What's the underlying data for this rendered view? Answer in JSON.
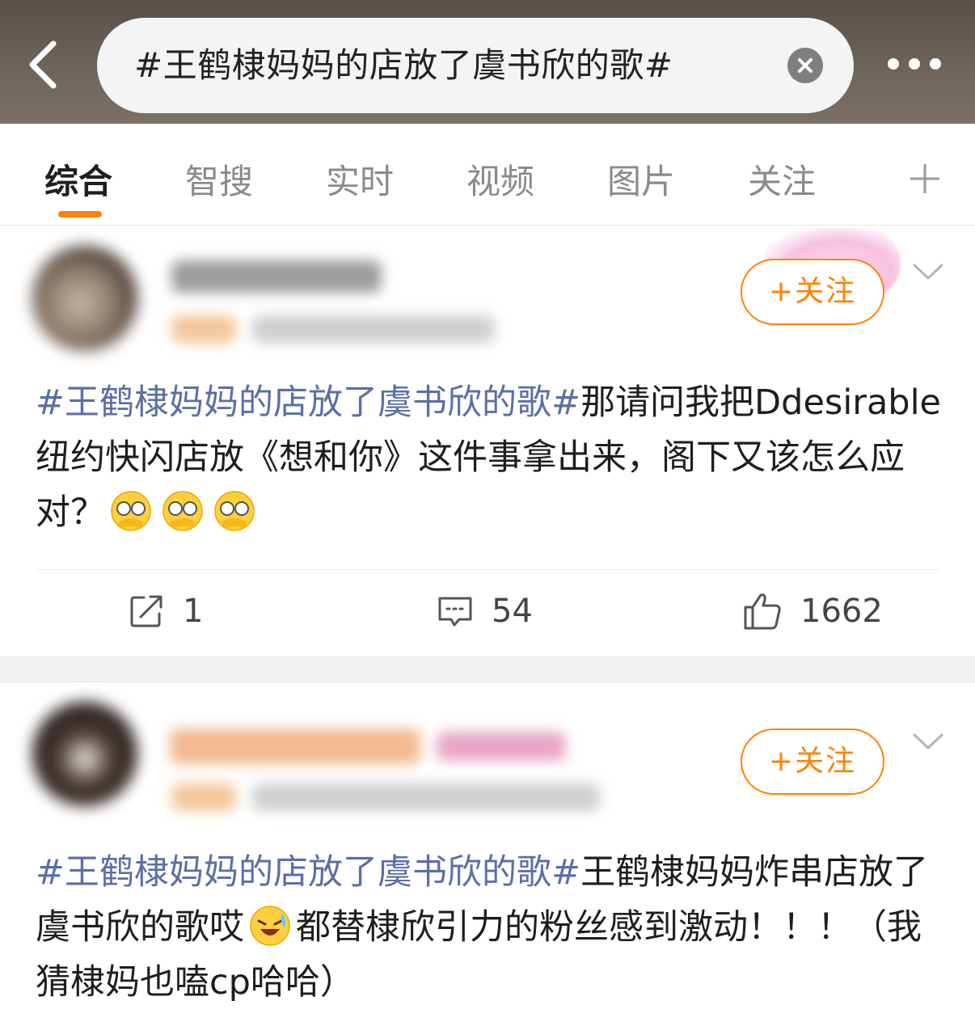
{
  "search": {
    "query": "#王鹤棣妈妈的店放了虞书欣的歌#"
  },
  "colors": {
    "accent": "#ff8200",
    "topic_link": "#5b6fa6",
    "topbar": "#6d645b"
  },
  "icons": {
    "back": "chevron-left-icon",
    "clear": "clear-icon",
    "more": "more-icon",
    "add_tab": "plus-icon",
    "repost": "repost-icon",
    "comment": "comment-icon",
    "like": "thumbs-up-icon",
    "post_menu": "chevron-down-icon"
  },
  "tabs": [
    {
      "label": "综合",
      "active": true
    },
    {
      "label": "智搜",
      "active": false
    },
    {
      "label": "实时",
      "active": false
    },
    {
      "label": "视频",
      "active": false
    },
    {
      "label": "图片",
      "active": false
    },
    {
      "label": "关注",
      "active": false
    }
  ],
  "posts": [
    {
      "follow_label": "+关注",
      "topic": "#王鹤棣妈妈的店放了虞书欣的歌#",
      "text": "那请问我把Ddesirable纽约快闪店放《想和你》这件事拿出来，阁下又该怎么应对？",
      "emojis": [
        "shy-peek-emoji",
        "shy-peek-emoji",
        "shy-peek-emoji"
      ],
      "reposts": "1",
      "comments": "54",
      "likes": "1662"
    },
    {
      "follow_label": "+关注",
      "topic": "#王鹤棣妈妈的店放了虞书欣的歌#",
      "text_before_emoji": "王鹤棣妈妈炸串店放了虞书欣的歌哎",
      "emoji": "laugh-cry-emoji",
      "text_after_emoji": "都替棣欣引力的粉丝感到激动！！！（我猜棣妈也嗑cp哈哈）"
    }
  ]
}
